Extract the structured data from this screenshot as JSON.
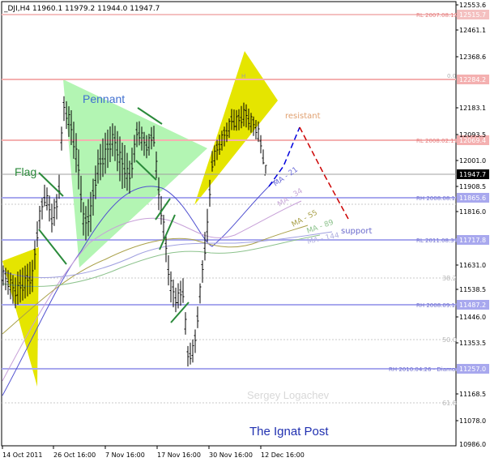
{
  "header": {
    "text": "_DJI,H4  11960.1 11979.2 11944.0 11947.7"
  },
  "price_scale": [
    "12553.6",
    "12515.7",
    "12461.1",
    "12368.6",
    "12284.2",
    "12183.1",
    "12093.5",
    "12069.4",
    "12001.0",
    "11947.7",
    "11908.5",
    "11865.6",
    "11816.0",
    "11717.8",
    "11631.0",
    "11538.5",
    "11487.2",
    "11446.0",
    "11353.5",
    "11257.0",
    "11168.5",
    "11078.0",
    "10986.0"
  ],
  "time_scale": [
    "14 Oct 2011",
    "26 Oct 16:00",
    "7 Nov 16:00",
    "17 Nov 16:00",
    "30 Nov 16:00",
    "12 Dec 16:00"
  ],
  "levels": [
    {
      "text": "RL  2007.08.12",
      "value": "12515.7",
      "kind": "red"
    },
    {
      "text": "0.0",
      "value": "12284.2",
      "kind": "red"
    },
    {
      "text": "RL  2008.02.11",
      "value": "12069.4",
      "kind": "red"
    },
    {
      "text": "RH  2008.08.11",
      "value": "11865.6",
      "kind": "blue"
    },
    {
      "text": "RL  2011.08.31",
      "value": "11717.8",
      "kind": "blue"
    },
    {
      "text": "RH  2008.09.19",
      "value": "11487.2",
      "kind": "blue"
    },
    {
      "text": "RH  2010.04.26 - Diamond",
      "value": "11257.0",
      "kind": "blue"
    }
  ],
  "fib": [
    "38.2",
    "50.0",
    "61.8"
  ],
  "current_price": "11947.7",
  "annotations": {
    "flag": "Flag",
    "pennant": "Pennant",
    "resistant": "resistant",
    "support": "support",
    "h_marker": "H",
    "author": "Sergey Logachev",
    "publisher": "The Ignat Post"
  },
  "ma_labels": [
    "MA - 21",
    "MA - 34",
    "MA - 55",
    "MA - 89",
    "MA - 144"
  ],
  "colors": {
    "yellow": "#e5e500",
    "green": "#b3f5b3",
    "resist_line": "#e46c6c",
    "support_line": "#9999ee",
    "blue_path": "#0000dd",
    "red_path": "#cc0000",
    "ma21": "#5050d0",
    "ma34": "#c7a0d8",
    "ma55": "#a9a048",
    "ma89": "#8cc28c",
    "ma144": "#a0a0e0",
    "fib_grid": "#c8c8c8"
  }
}
